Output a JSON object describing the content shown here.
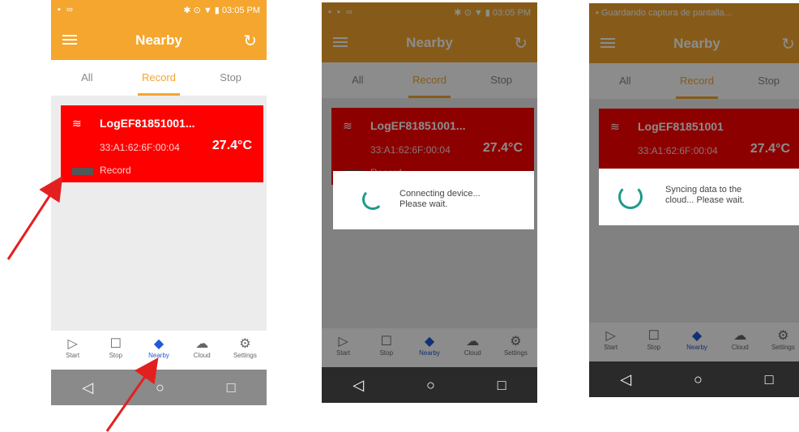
{
  "status_bar": {
    "time": "03:05 PM",
    "saving_notice": "Guardando captura de pantalla..."
  },
  "appbar": {
    "title": "Nearby"
  },
  "tabs": [
    {
      "label": "All"
    },
    {
      "label": "Record"
    },
    {
      "label": "Stop"
    }
  ],
  "device": {
    "name": "LogEF81851001...",
    "name_p3": "LogEF81851001",
    "mac": "33:A1:62:6F:00:04",
    "temperature": "27.4°C",
    "status": "Record"
  },
  "bottom_nav": [
    {
      "label": "Start",
      "icon": "play-icon"
    },
    {
      "label": "Stop",
      "icon": "stop-icon"
    },
    {
      "label": "Nearby",
      "icon": "compass-icon"
    },
    {
      "label": "Cloud",
      "icon": "cloud-icon"
    },
    {
      "label": "Settings",
      "icon": "gear-icon"
    }
  ],
  "dialogs": {
    "connecting": {
      "line1": "Connecting device...",
      "line2": "Please wait."
    },
    "syncing": {
      "line1": "Syncing data to the",
      "line2": "cloud... Please wait."
    }
  },
  "colors": {
    "accent": "#f4a62e",
    "record_card": "#ff0000",
    "active_nav": "#1f5ad6",
    "spinner": "#1e9a8a",
    "annotation_arrow": "#e32020"
  }
}
